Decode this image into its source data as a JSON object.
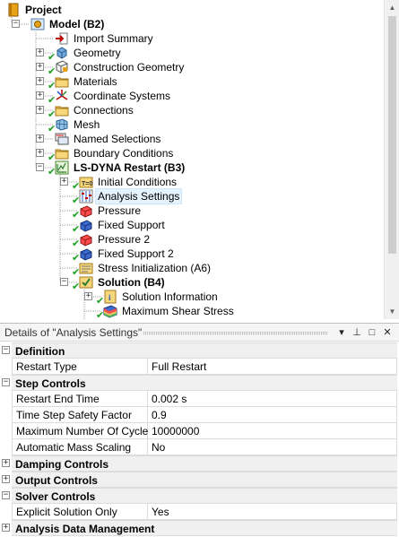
{
  "tree": {
    "nodes": [
      {
        "id": "project",
        "label": "Project",
        "bold": true,
        "icon": "project-book-icon",
        "expander": "",
        "check": false
      },
      {
        "id": "model",
        "label": "Model (B2)",
        "bold": true,
        "icon": "model-icon",
        "expander": "−",
        "check": false
      },
      {
        "id": "import-summary",
        "label": "Import Summary",
        "bold": false,
        "icon": "import-arrow-icon",
        "expander": "",
        "check": false
      },
      {
        "id": "geometry",
        "label": "Geometry",
        "bold": false,
        "icon": "geometry-cube-icon",
        "expander": "+",
        "check": true
      },
      {
        "id": "construction-geometry",
        "label": "Construction Geometry",
        "bold": false,
        "icon": "construction-geometry-icon",
        "expander": "+",
        "check": true
      },
      {
        "id": "materials",
        "label": "Materials",
        "bold": false,
        "icon": "materials-folder-icon",
        "expander": "+",
        "check": true
      },
      {
        "id": "coordinate-systems",
        "label": "Coordinate Systems",
        "bold": false,
        "icon": "coordinate-axes-icon",
        "expander": "+",
        "check": true
      },
      {
        "id": "connections",
        "label": "Connections",
        "bold": false,
        "icon": "connections-folder-icon",
        "expander": "+",
        "check": true
      },
      {
        "id": "mesh",
        "label": "Mesh",
        "bold": false,
        "icon": "mesh-icon",
        "expander": "",
        "check": true
      },
      {
        "id": "named-selections",
        "label": "Named Selections",
        "bold": false,
        "icon": "named-selections-icon",
        "expander": "+",
        "check": false
      },
      {
        "id": "boundary-conditions",
        "label": "Boundary Conditions",
        "bold": false,
        "icon": "boundary-conditions-folder-icon",
        "expander": "+",
        "check": true
      },
      {
        "id": "ls-dyna-restart",
        "label": "LS-DYNA Restart (B3)",
        "bold": true,
        "icon": "ls-dyna-analysis-icon",
        "expander": "−",
        "check": true
      },
      {
        "id": "initial-conditions",
        "label": "Initial Conditions",
        "bold": false,
        "icon": "initial-conditions-icon",
        "expander": "+",
        "check": true
      },
      {
        "id": "analysis-settings",
        "label": "Analysis Settings",
        "bold": false,
        "icon": "analysis-settings-icon",
        "expander": "",
        "check": true,
        "selected": true
      },
      {
        "id": "pressure",
        "label": "Pressure",
        "bold": false,
        "icon": "pressure-icon",
        "expander": "",
        "check": true
      },
      {
        "id": "fixed-support",
        "label": "Fixed Support",
        "bold": false,
        "icon": "fixed-support-icon",
        "expander": "",
        "check": true
      },
      {
        "id": "pressure-2",
        "label": "Pressure 2",
        "bold": false,
        "icon": "pressure-icon",
        "expander": "",
        "check": true
      },
      {
        "id": "fixed-support-2",
        "label": "Fixed Support 2",
        "bold": false,
        "icon": "fixed-support-icon",
        "expander": "",
        "check": true
      },
      {
        "id": "stress-initialization",
        "label": "Stress Initialization (A6)",
        "bold": false,
        "icon": "stress-initialization-icon",
        "expander": "",
        "check": true
      },
      {
        "id": "solution",
        "label": "Solution (B4)",
        "bold": true,
        "icon": "solution-icon",
        "expander": "−",
        "check": true
      },
      {
        "id": "solution-information",
        "label": "Solution Information",
        "bold": false,
        "icon": "solution-information-icon",
        "expander": "+",
        "check": true
      },
      {
        "id": "maximum-shear-stress",
        "label": "Maximum Shear Stress",
        "bold": false,
        "icon": "result-contour-icon",
        "expander": "",
        "check": true
      }
    ]
  },
  "details": {
    "title": "Details of \"Analysis Settings\"",
    "header_buttons": {
      "dropdown": "▾",
      "pin": "⊥",
      "float": "□",
      "close": "✕"
    },
    "rows": [
      {
        "type": "section",
        "label": "Definition",
        "toggle": "−"
      },
      {
        "type": "prop",
        "name": "Restart Type",
        "value": "Full Restart"
      },
      {
        "type": "section",
        "label": "Step Controls",
        "toggle": "−"
      },
      {
        "type": "prop",
        "name": "Restart End Time",
        "value": "0.002 s"
      },
      {
        "type": "prop",
        "name": "Time Step Safety Factor",
        "value": "0.9"
      },
      {
        "type": "prop",
        "name": "Maximum Number Of Cycles",
        "value": "10000000"
      },
      {
        "type": "prop",
        "name": "Automatic Mass Scaling",
        "value": "No"
      },
      {
        "type": "section",
        "label": "Damping Controls",
        "toggle": "+"
      },
      {
        "type": "section",
        "label": "Output Controls",
        "toggle": "+"
      },
      {
        "type": "section",
        "label": "Solver Controls",
        "toggle": "−"
      },
      {
        "type": "prop",
        "name": "Explicit Solution Only",
        "value": "Yes"
      },
      {
        "type": "section",
        "label": "Analysis Data Management",
        "toggle": "+"
      }
    ]
  }
}
